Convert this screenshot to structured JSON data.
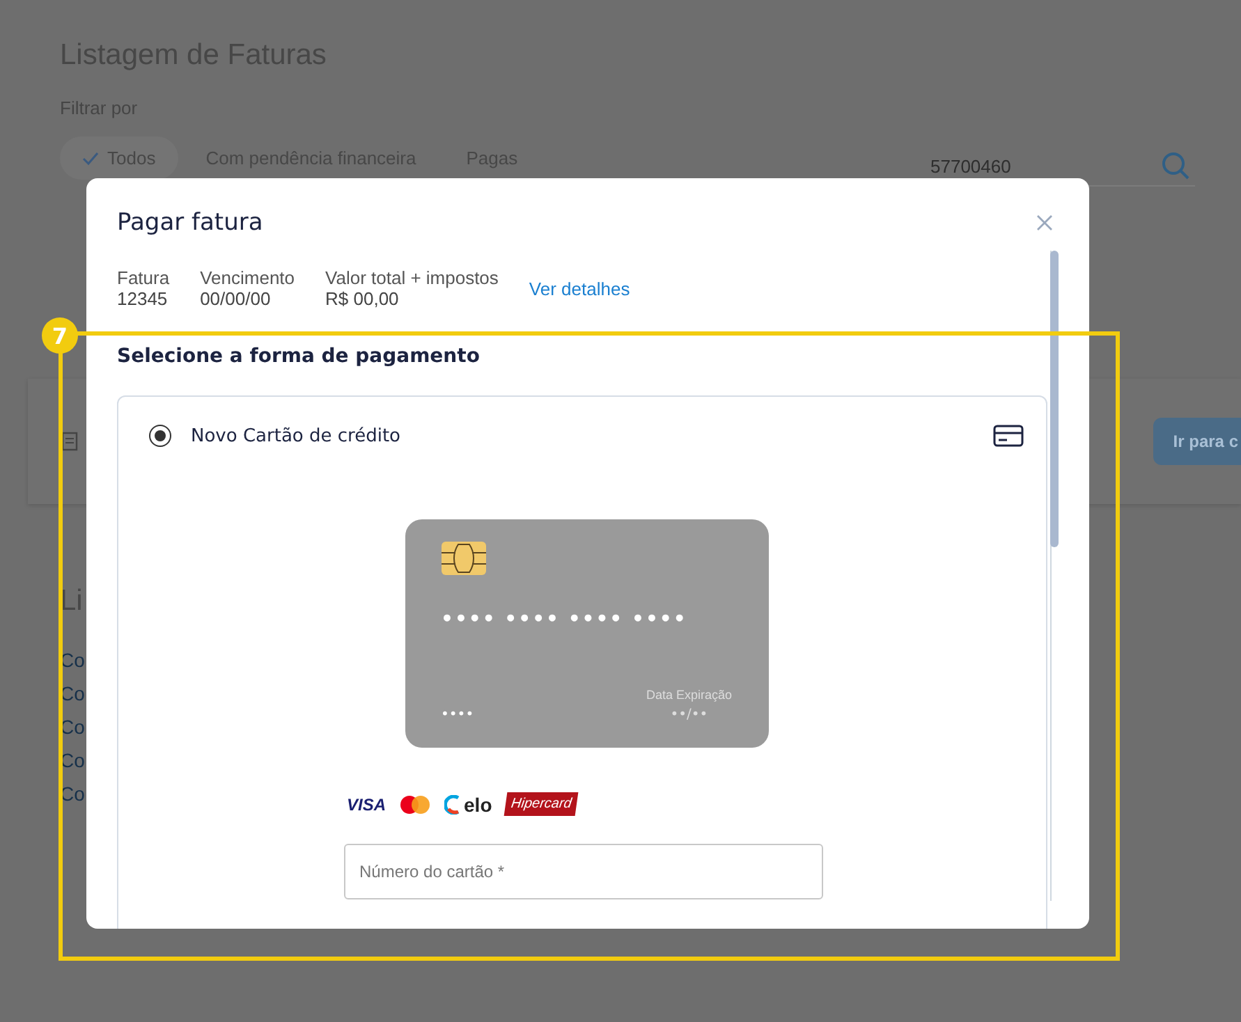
{
  "page": {
    "title": "Listagem de Faturas",
    "filter_label": "Filtrar por",
    "filters": [
      {
        "label": "Todos",
        "selected": true
      },
      {
        "label": "Com pendência financeira",
        "selected": false
      },
      {
        "label": "Pagas",
        "selected": false
      }
    ],
    "search": {
      "value": "57700460"
    },
    "panel_button": "Ir para c",
    "section_title": "Li",
    "links": [
      "Co",
      "Co",
      "Co",
      "Co",
      "Co"
    ]
  },
  "modal": {
    "title": "Pagar fatura",
    "info": [
      {
        "label": "Fatura",
        "value": "12345"
      },
      {
        "label": "Vencimento",
        "value": "00/00/00"
      },
      {
        "label": "Valor total + impostos",
        "value": "R$ 00,00"
      }
    ],
    "details_link": "Ver detalhes",
    "payment_heading": "Selecione a forma de pagamento",
    "option": {
      "label": "Novo Cartão de crédito",
      "selected": true
    },
    "card": {
      "number": "•••• •••• •••• ••••",
      "cvv": "••••",
      "expiry_label": "Data Expiração",
      "expiry": "••/••"
    },
    "brands": [
      {
        "kind": "visa",
        "text": "VISA"
      },
      {
        "kind": "mastercard"
      },
      {
        "kind": "elo",
        "text": "elo"
      },
      {
        "kind": "hipercard",
        "text": "Hipercard"
      }
    ],
    "card_number_field": {
      "placeholder": "Número do cartão *"
    }
  },
  "annotation": {
    "number": "7"
  }
}
